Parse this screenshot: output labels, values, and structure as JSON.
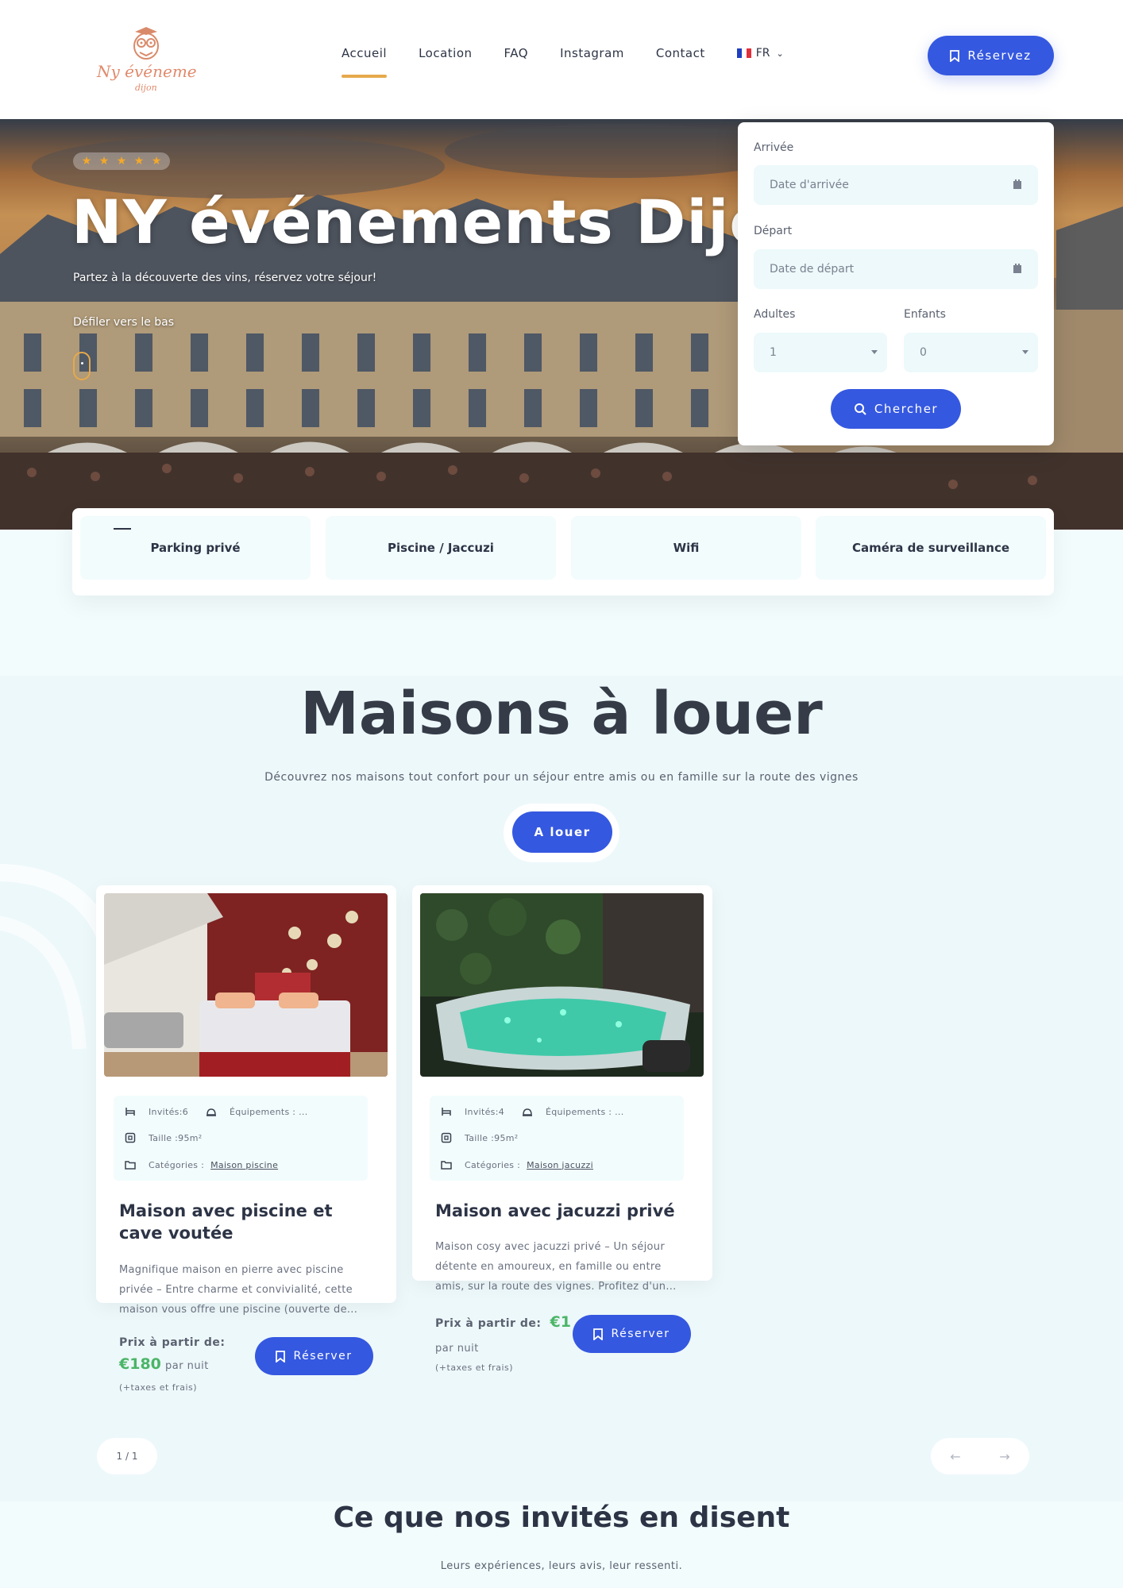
{
  "brand": {
    "logo_text": "Ny événement",
    "logo_subtext": "dijon",
    "accent": "#e6a94b",
    "primary": "#3558e0",
    "price_green": "#4bb567"
  },
  "nav": {
    "items": [
      "Accueil",
      "Location",
      "FAQ",
      "Instagram",
      "Contact"
    ],
    "active": "Accueil",
    "lang": "FR",
    "cta": "Réservez"
  },
  "hero": {
    "rating_stars": 5,
    "title": "NY événements Dijon",
    "subtitle": "Partez à la découverte des vins, réservez votre séjour!",
    "scroll_hint": "Défiler vers le bas"
  },
  "booking": {
    "arrival_label": "Arrivée",
    "arrival_placeholder": "Date d'arrivée",
    "departure_label": "Départ",
    "departure_placeholder": "Date de départ",
    "adults_label": "Adultes",
    "adults_value": "1",
    "children_label": "Enfants",
    "children_value": "0",
    "search_button": "Chercher"
  },
  "features": [
    "Parking privé",
    "Piscine / Jaccuzi",
    "Wifi",
    "Caméra de surveillance"
  ],
  "section": {
    "title": "Maisons à louer",
    "subtitle": "Découvrez nos maisons tout confort pour un séjour entre amis ou en famille sur la route des vignes",
    "button": "A louer"
  },
  "houses": [
    {
      "guests": "Invités:6",
      "equipment": "Équipements : ...",
      "size": "Taille :95m²",
      "categories_label": "Catégories :",
      "category": "Maison piscine",
      "title": "Maison avec piscine et cave voutée",
      "description": "Magnifique maison en pierre avec piscine privée – Entre charme et convivialité, cette maison vous offre une piscine (ouverte de...",
      "price_label": "Prix à partir de:",
      "price": "€180",
      "price_unit": "par nuit",
      "price_note": "(+taxes et frais)",
      "button": "Réserver"
    },
    {
      "guests": "Invités:4",
      "equipment": "Équipements : ...",
      "size": "Taille :95m²",
      "categories_label": "Catégories :",
      "category": "Maison jacuzzi",
      "title": "Maison avec jacuzzi privé",
      "description": "Maison cosy avec jacuzzi privé – Un séjour détente en amoureux, en famille ou entre amis, sur la route des vignes. Profitez d'un...",
      "price_label": "Prix à partir de:",
      "price": "€1",
      "price_unit": "par nuit",
      "price_note": "(+taxes et frais)",
      "button": "Réserver"
    }
  ],
  "pager": {
    "label": "1 / 1",
    "prev_icon": "arrow-left-icon",
    "next_icon": "arrow-right-icon"
  },
  "testimonials": {
    "title": "Ce que nos invités en disent",
    "subtitle": "Leurs expériences, leurs avis, leur ressenti."
  }
}
